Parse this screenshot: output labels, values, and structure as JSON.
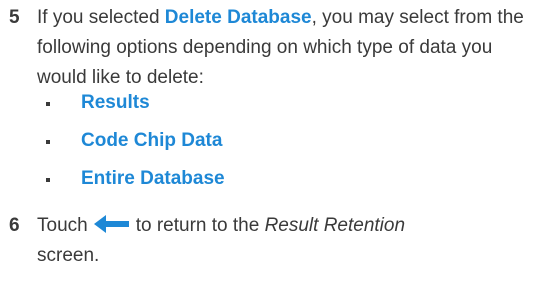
{
  "step5": {
    "number": "5",
    "intro": "If you selected ",
    "highlight": "Delete Database",
    "rest": ", you may select from the following options depending on which type of data you would like to delete:",
    "options": [
      "Results",
      "Code Chip Data",
      "Entire Database"
    ]
  },
  "step6": {
    "number": "6",
    "pre": "Touch",
    "icon": "back-arrow-icon",
    "mid": "to return to the ",
    "screen_name": "Result Retention",
    "post": "screen."
  },
  "colors": {
    "accent": "#1e88d6",
    "text": "#3a3a3a"
  }
}
